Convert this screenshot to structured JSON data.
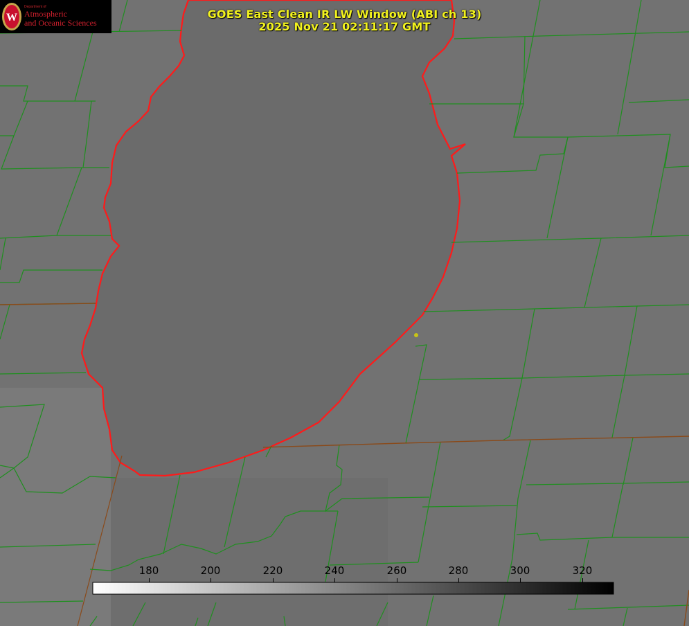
{
  "title": {
    "line1": "GOES East Clean IR LW Window (ABI ch 13)",
    "line2": "2025 Nov 21 02:11:17 GMT"
  },
  "logo": {
    "department": "Department of",
    "line1": "Atmospheric",
    "line2": "and Oceanic Sciences"
  },
  "colorbar": {
    "ticks": [
      "180",
      "200",
      "220",
      "240",
      "260",
      "280",
      "300",
      "320"
    ],
    "gradient_start": "#ffffff",
    "gradient_end": "#000000"
  },
  "colors": {
    "county_lines": "#1f8f1f",
    "state_lines": "#8a4a1a",
    "coastline": "#ff1a1a",
    "title": "#f2f21e",
    "logo_text": "#d2202e"
  }
}
